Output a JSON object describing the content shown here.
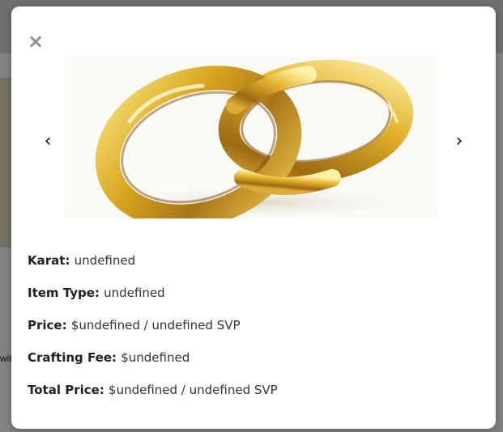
{
  "background": {
    "partial_text": "wit"
  },
  "modal": {
    "close_symbol": "×",
    "carousel": {
      "prev_symbol": "‹",
      "next_symbol": "›",
      "image_subject": "two interlocking gold wedding rings"
    },
    "details": [
      {
        "label": "Karat:",
        "value": "undefined"
      },
      {
        "label": "Item Type:",
        "value": "undefined"
      },
      {
        "label": "Price:",
        "value": "$undefined / undefined SVP"
      },
      {
        "label": "Crafting Fee:",
        "value": "$undefined"
      },
      {
        "label": "Total Price:",
        "value": "$undefined / undefined SVP"
      }
    ]
  },
  "colors": {
    "overlay": "#6f6f6f",
    "modal": "#ffffff",
    "gold": "#d4a520"
  }
}
